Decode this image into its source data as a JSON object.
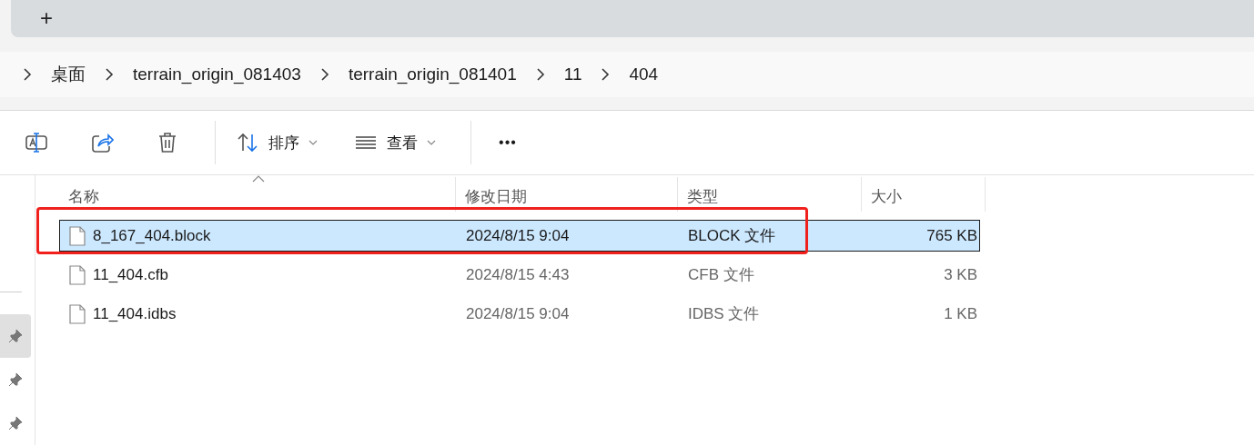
{
  "tab_strip": {
    "new_tab": "+"
  },
  "breadcrumb": [
    "桌面",
    "terrain_origin_081403",
    "terrain_origin_081401",
    "11",
    "404"
  ],
  "toolbar": [
    {
      "kind": "rename"
    },
    {
      "kind": "share"
    },
    {
      "kind": "delete"
    },
    {
      "kind": "sort",
      "label": "排序"
    },
    {
      "kind": "view",
      "label": "查看"
    },
    {
      "kind": "more",
      "label": "•••"
    }
  ],
  "columns": [
    {
      "label": "名称",
      "sorted": true
    },
    {
      "label": "修改日期",
      "sorted": false
    },
    {
      "label": "类型",
      "sorted": false
    },
    {
      "label": "大小",
      "sorted": false
    }
  ],
  "rows": [
    {
      "name": "8_167_404.block",
      "modified": "2024/8/15 9:04",
      "type": "BLOCK 文件",
      "size": "765 KB",
      "selected": true,
      "annotated": true
    },
    {
      "name": "11_404.cfb",
      "modified": "2024/8/15 4:43",
      "type": "CFB 文件",
      "size": "3 KB",
      "selected": false,
      "annotated": false
    },
    {
      "name": "11_404.idbs",
      "modified": "2024/8/15 9:04",
      "type": "IDBS 文件",
      "size": "1 KB",
      "selected": false,
      "annotated": false
    }
  ],
  "pinned": [
    {
      "selected": true
    },
    {
      "selected": false
    },
    {
      "selected": false
    }
  ]
}
